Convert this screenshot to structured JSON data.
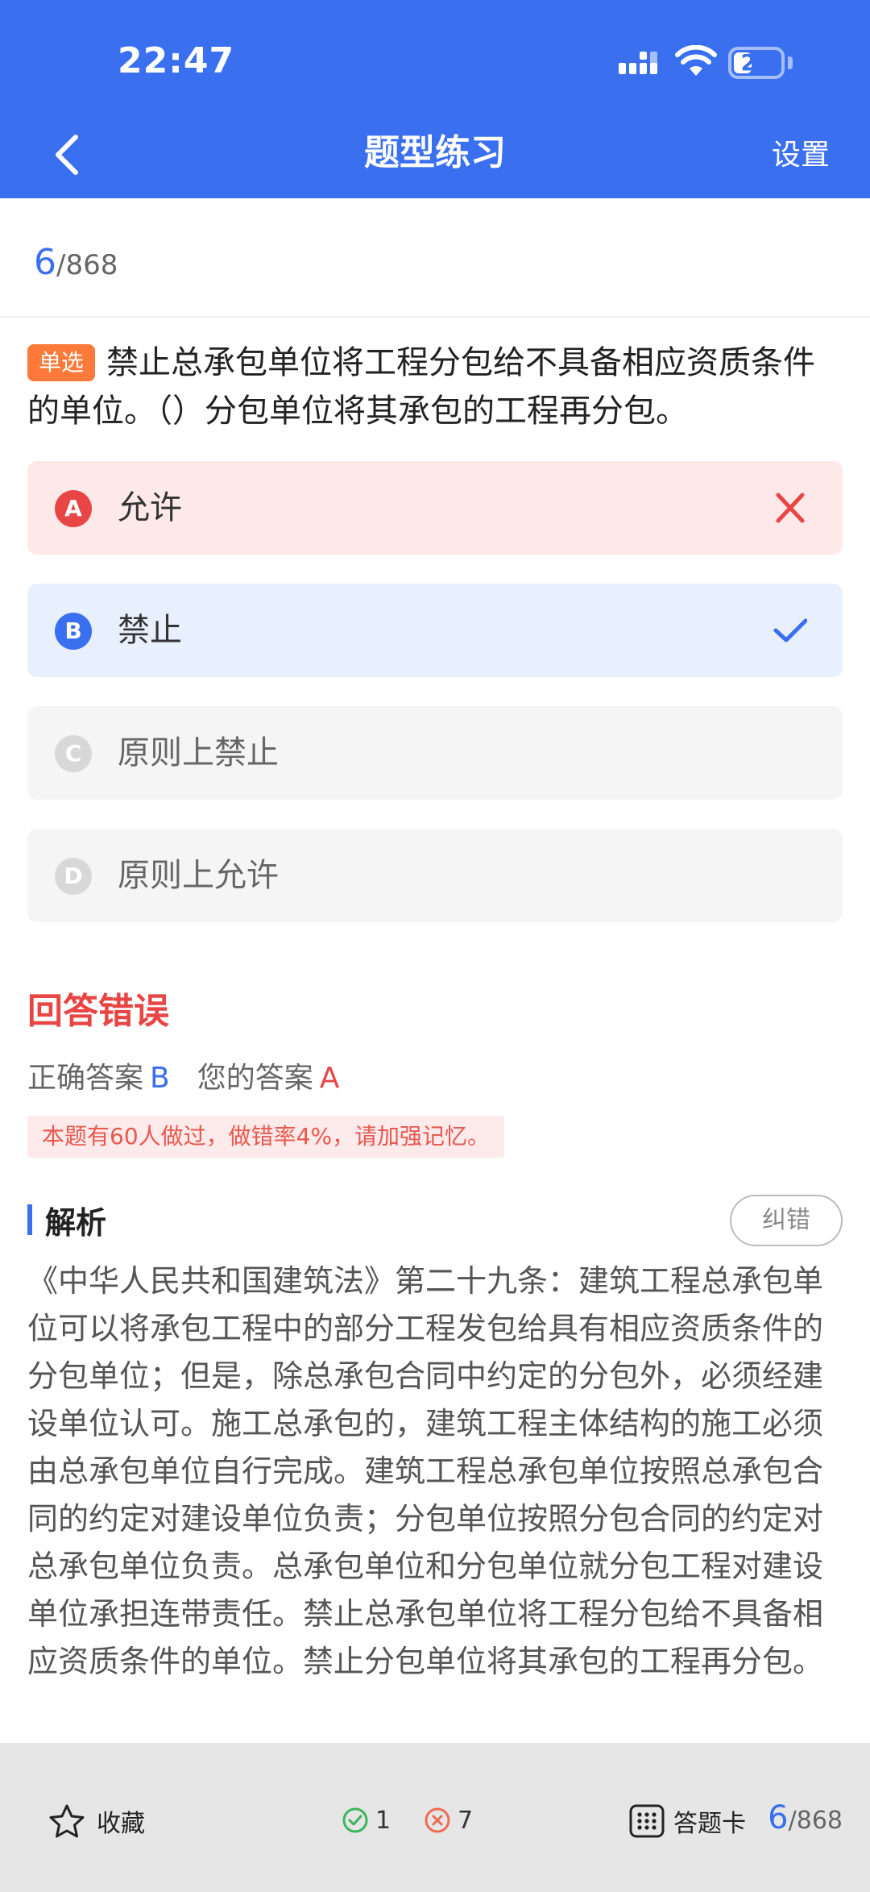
{
  "status_bar": {
    "time": "22:47",
    "battery": "21"
  },
  "header": {
    "title": "题型练习",
    "settings_label": "设置"
  },
  "progress": {
    "current": "6",
    "total": "/868"
  },
  "question": {
    "type_tag": "单选",
    "text": "禁止总承包单位将工程分包给不具备相应资质条件的单位。（）分包单位将其承包的工程再分包。"
  },
  "options": [
    {
      "letter": "A",
      "text": "允许",
      "state": "wrong"
    },
    {
      "letter": "B",
      "text": "禁止",
      "state": "correct"
    },
    {
      "letter": "C",
      "text": "原则上禁止",
      "state": "plain"
    },
    {
      "letter": "D",
      "text": "原则上允许",
      "state": "plain"
    }
  ],
  "result": {
    "title": "回答错误",
    "correct_label": "正确答案",
    "correct_value": "B",
    "mine_label": "您的答案",
    "mine_value": "A",
    "hint": "本题有60人做过，做错率4%，请加强记忆。"
  },
  "analysis": {
    "title": "解析",
    "report_label": "纠错",
    "text": "《中华人民共和国建筑法》第二十九条：建筑工程总承包单位可以将承包工程中的部分工程发包给具有相应资质条件的分包单位；但是，除总承包合同中约定的分包外，必须经建设单位认可。施工总承包的，建筑工程主体结构的施工必须由总承包单位自行完成。建筑工程总承包单位按照总承包合同的约定对建设单位负责；分包单位按照分包合同的约定对总承包单位负责。总承包单位和分包单位就分包工程对建设单位承担连带责任。禁止总承包单位将工程分包给不具备相应资质条件的单位。禁止分包单位将其承包的工程再分包。"
  },
  "bottom_bar": {
    "favorite_label": "收藏",
    "correct_count": "1",
    "wrong_count": "7",
    "answer_card_label": "答题卡",
    "progress_current": "6",
    "progress_total": "/868"
  },
  "colors": {
    "brand": "#3a6ff0",
    "error": "#e84545",
    "tag": "#ff7a3a"
  },
  "icons": [
    "back-icon",
    "signal-icon",
    "wifi-icon",
    "battery-icon",
    "cross-icon",
    "check-icon",
    "star-icon",
    "check-circle-icon",
    "cross-circle-icon",
    "grid-icon"
  ]
}
